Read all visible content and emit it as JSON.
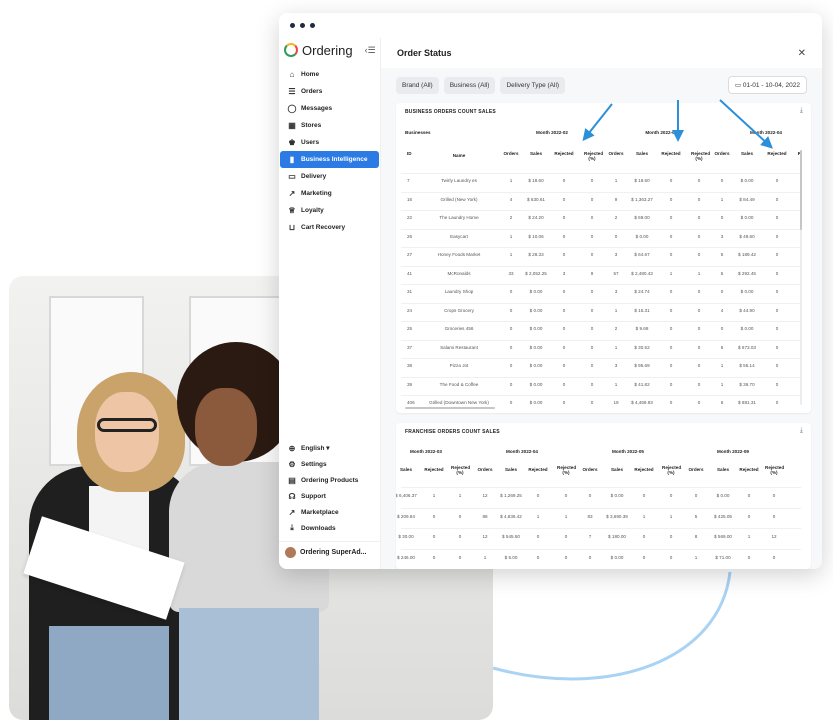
{
  "app": {
    "brand": "Ordering",
    "window_dots": 3
  },
  "sidebar": {
    "items": [
      {
        "label": "Home",
        "icon": "home-icon"
      },
      {
        "label": "Orders",
        "icon": "list-icon"
      },
      {
        "label": "Messages",
        "icon": "message-icon"
      },
      {
        "label": "Stores",
        "icon": "store-icon"
      },
      {
        "label": "Users",
        "icon": "users-icon"
      },
      {
        "label": "Business Intelligence",
        "icon": "chart-icon",
        "active": true
      },
      {
        "label": "Delivery",
        "icon": "truck-icon"
      },
      {
        "label": "Marketing",
        "icon": "graph-icon"
      },
      {
        "label": "Loyalty",
        "icon": "trophy-icon"
      },
      {
        "label": "Cart Recovery",
        "icon": "cart-icon"
      }
    ],
    "bottom_items": [
      {
        "label": "English ▾",
        "icon": "globe-icon"
      },
      {
        "label": "Settings",
        "icon": "gear-icon"
      },
      {
        "label": "Ordering Products",
        "icon": "products-icon"
      },
      {
        "label": "Support",
        "icon": "headset-icon"
      },
      {
        "label": "Marketplace",
        "icon": "external-icon"
      },
      {
        "label": "Downloads",
        "icon": "download-icon"
      }
    ],
    "user": "Ordering SuperAd..."
  },
  "main": {
    "title": "Order Status",
    "filters": [
      "Brand (All)",
      "Business (All)",
      "Delivery Type (All)"
    ],
    "date_range": "01-01 - 10-04, 2022"
  },
  "business_table": {
    "title": "BUSINESS ORDERS COUNT SALES",
    "businesses_label": "Businesses",
    "months": [
      "Month 2022-02",
      "Month 2022-0",
      "Month 2022-04"
    ],
    "columns": [
      "ID",
      "Name",
      "Orders",
      "Sales",
      "Rejected",
      "Rejected (%)",
      "Orders",
      "Sales",
      "Rejected",
      "Rejected (%)",
      "Orders",
      "Sales",
      "Rejected",
      "Ri"
    ],
    "rows": [
      [
        "7",
        "Twirly Laundry es",
        "1",
        "$ 18.60",
        "0",
        "0",
        "1",
        "$ 18.60",
        "0",
        "0",
        "0",
        "$ 0.00",
        "0"
      ],
      [
        "16",
        "Grilled (New York)",
        "4",
        "$ 630.61",
        "0",
        "0",
        "9",
        "$ 1,363.27",
        "0",
        "0",
        "1",
        "$ 84.49",
        "0"
      ],
      [
        "22",
        "The Laundry Home",
        "2",
        "$ 24.20",
        "0",
        "0",
        "2",
        "$ 69.00",
        "0",
        "0",
        "0",
        "$ 0.00",
        "0"
      ],
      [
        "26",
        "Easycart",
        "1",
        "$ 10.06",
        "0",
        "0",
        "0",
        "$ 0.00",
        "0",
        "0",
        "3",
        "$ 48.60",
        "0"
      ],
      [
        "27",
        "Honey Foods Market",
        "1",
        "$ 28.33",
        "0",
        "0",
        "3",
        "$ 64.67",
        "0",
        "0",
        "5",
        "$ 189.42",
        "0"
      ],
      [
        "41",
        "McRonalds",
        "33",
        "$ 2,052.25",
        "3",
        "9",
        "57",
        "$ 2,480.43",
        "1",
        "1",
        "5",
        "$ 292.45",
        "0"
      ],
      [
        "31",
        "Laundry Shop",
        "0",
        "$ 0.00",
        "0",
        "0",
        "3",
        "$ 24.74",
        "0",
        "0",
        "0",
        "$ 0.00",
        "0"
      ],
      [
        "24",
        "Crops Grocery",
        "0",
        "$ 0.00",
        "0",
        "0",
        "1",
        "$ 15.31",
        "0",
        "0",
        "4",
        "$ 44.90",
        "0"
      ],
      [
        "25",
        "Groceries 456",
        "0",
        "$ 0.00",
        "0",
        "0",
        "2",
        "$ 9.68",
        "0",
        "0",
        "0",
        "$ 0.00",
        "0"
      ],
      [
        "37",
        "Salami Restaurant",
        "0",
        "$ 0.00",
        "0",
        "0",
        "1",
        "$ 30.52",
        "0",
        "0",
        "6",
        "$ 673.03",
        "0"
      ],
      [
        "38",
        "Pizza Jot",
        "0",
        "$ 0.00",
        "0",
        "0",
        "3",
        "$ 95.69",
        "0",
        "0",
        "1",
        "$ 55.14",
        "0"
      ],
      [
        "39",
        "The Food & Coffee",
        "0",
        "$ 0.00",
        "0",
        "0",
        "1",
        "$ 41.82",
        "0",
        "0",
        "1",
        "$ 36.70",
        "0"
      ],
      [
        "406",
        "Grilled (Downtown New York)",
        "0",
        "$ 0.00",
        "0",
        "0",
        "19",
        "$ 4,469.93",
        "0",
        "0",
        "6",
        "$ 881.31",
        "0"
      ]
    ]
  },
  "franchise_table": {
    "title": "FRANCHISE ORDERS COUNT SALES",
    "months": [
      "Month 2022-03",
      "Month 2022-04",
      "Month 2022-05",
      "Month 2022-09"
    ],
    "columns": [
      "Sales",
      "Rejected",
      "Rejected (%)",
      "Orders",
      "Sales",
      "Rejected",
      "Rejected (%)",
      "Orders",
      "Sales",
      "Rejected",
      "Rejected (%)",
      "Orders",
      "Sales",
      "Rejected",
      "Rejected (%)"
    ],
    "rows": [
      [
        "$ 6,406.37",
        "1",
        "1",
        "12",
        "$ 1,269.25",
        "0",
        "0",
        "0",
        "$ 0.00",
        "0",
        "0",
        "0",
        "$ 0.00",
        "0",
        "0"
      ],
      [
        "$ 209.84",
        "0",
        "0",
        "88",
        "$ 4,836.42",
        "1",
        "1",
        "83",
        "$ 3,690.39",
        "1",
        "1",
        "5",
        "$ 425.05",
        "0",
        "0"
      ],
      [
        "$ 30.00",
        "0",
        "0",
        "12",
        "$ 545.50",
        "0",
        "0",
        "7",
        "$ 180.00",
        "0",
        "0",
        "8",
        "$ 569.00",
        "1",
        "12"
      ],
      [
        "$ 246.00",
        "0",
        "0",
        "1",
        "$ 5.00",
        "0",
        "0",
        "0",
        "$ 0.00",
        "0",
        "0",
        "1",
        "$ 71.00",
        "0",
        "0"
      ]
    ]
  },
  "colors": {
    "accent": "#2c7be5",
    "arrow": "#2b8fd9",
    "curve": "#a9d3f5"
  }
}
